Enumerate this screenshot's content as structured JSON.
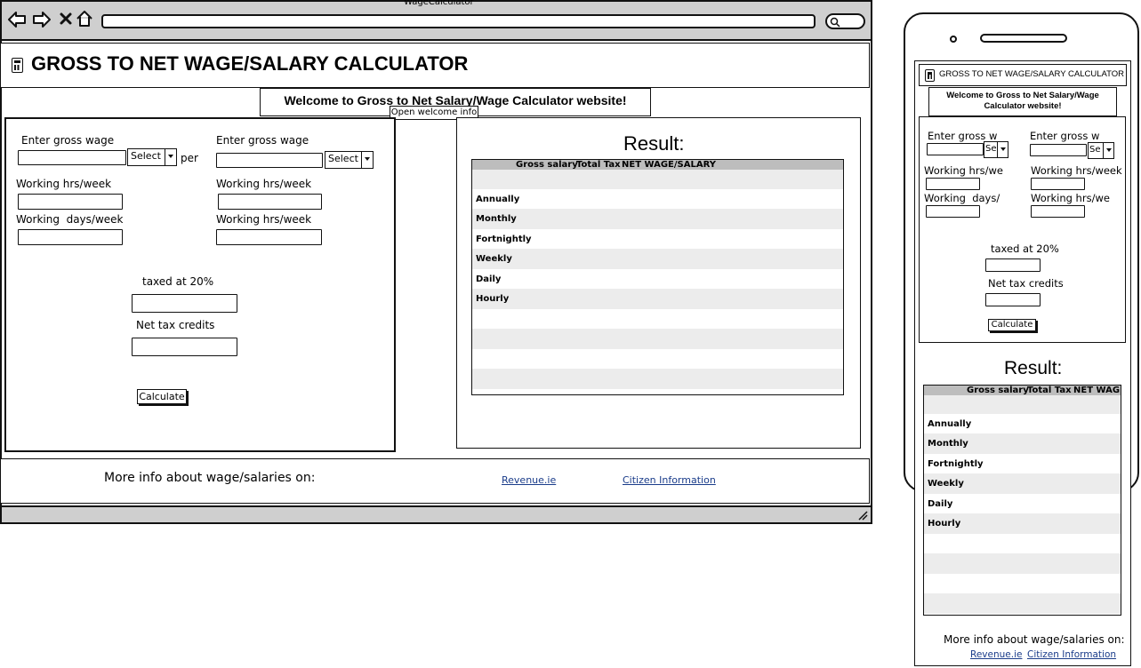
{
  "browser": {
    "window_title": "WageCalculator",
    "nav_icons": [
      "back-arrow-icon",
      "forward-arrow-icon",
      "close-x-icon",
      "home-icon"
    ],
    "search_icon": "search-icon"
  },
  "header": {
    "title": "GROSS TO NET WAGE/SALARY CALCULATOR",
    "icon": "calculator-icon"
  },
  "welcome": {
    "text": "Welcome to Gross to Net Salary/Wage Calculator website!",
    "button_label": "Open welcome info"
  },
  "form": {
    "left": {
      "gross_label": "Enter gross wage",
      "select_label": "Select",
      "per_label": "per",
      "hours_label": "Working hrs/week",
      "days_label": "Working  days/week"
    },
    "right": {
      "gross_label": "Enter gross wage",
      "select_label": "Select",
      "hours_label": "Working hrs/week",
      "hours2_label": "Working hrs/week"
    },
    "taxed_label": "taxed at 20%",
    "credits_label": "Net tax credits",
    "calculate_label": "Calculate"
  },
  "result": {
    "title": "Result:",
    "columns": [
      "Gross salary",
      "Total Tax",
      "NET WAGE/SALARY"
    ],
    "rows": [
      "Annually",
      "Monthly",
      "Fortnightly",
      "Weekly",
      "Daily",
      "Hourly"
    ]
  },
  "footer": {
    "text": "More info about wage/salaries on:",
    "link1": "Revenue.ie",
    "link2": "Citizen Information"
  },
  "mobile": {
    "header_title": "GROSS TO NET WAGE/SALARY CALCULATOR",
    "welcome_text": "Welcome to Gross to Net Salary/Wage Calculator website!",
    "gross_label": "Enter gross w",
    "select_label": "Se",
    "left_hours_label": "Working hrs/we",
    "left_days_label": "Working  days/",
    "right_hours_label": "Working hrs/week",
    "right_hours2_label": "Working hrs/we",
    "taxed_label": "taxed at 20%",
    "credits_label": "Net tax credits",
    "calculate_label": "Calculate",
    "result_title": "Result:",
    "columns": [
      "Gross salary",
      "Total Tax",
      "NET WAG"
    ],
    "rows": [
      "Annually",
      "Monthly",
      "Fortnightly",
      "Weekly",
      "Daily",
      "Hourly"
    ],
    "footer_text": "More info about wage/salaries on:",
    "link1": "Revenue.ie",
    "link2": "Citizen Information"
  }
}
